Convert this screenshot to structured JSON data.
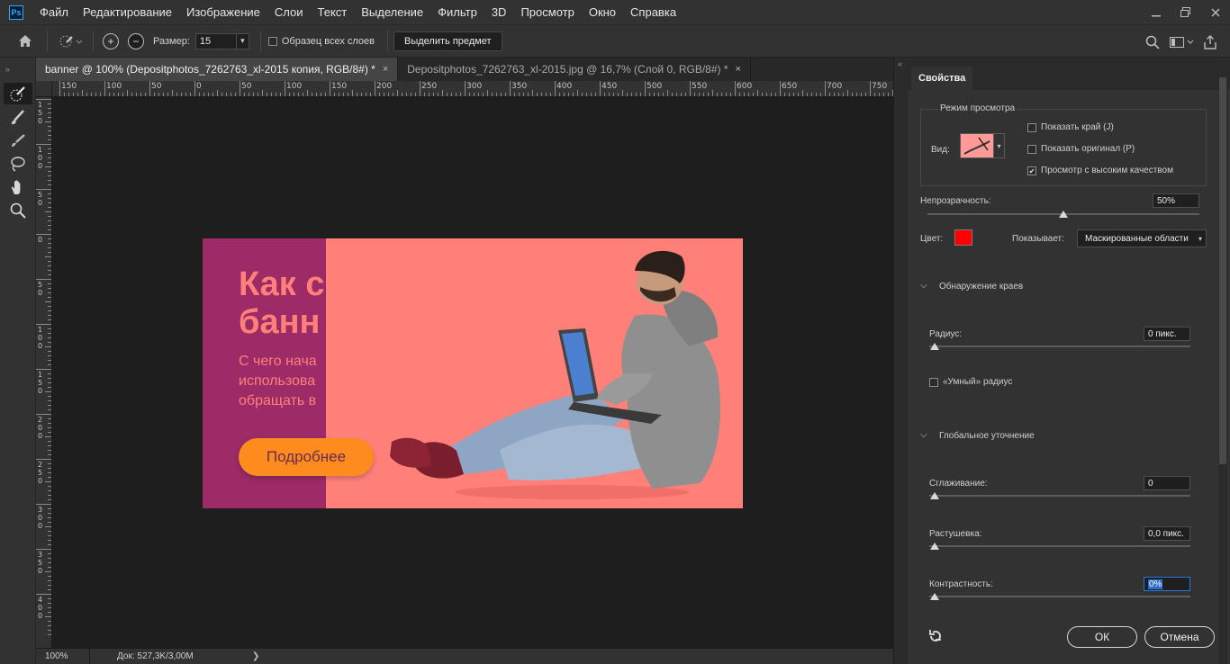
{
  "app": {
    "logo_text": "Ps"
  },
  "menu": [
    "Файл",
    "Редактирование",
    "Изображение",
    "Слои",
    "Текст",
    "Выделение",
    "Фильтр",
    "3D",
    "Просмотр",
    "Окно",
    "Справка"
  ],
  "options_bar": {
    "size_label": "Размер:",
    "size_value": "15",
    "sample_all_layers": "Образец всех слоев",
    "select_subject": "Выделить предмет"
  },
  "tabs": [
    {
      "label": "banner @ 100% (Depositphotos_7262763_xl-2015 копия, RGB/8#) *",
      "active": true
    },
    {
      "label": "Depositphotos_7262763_xl-2015.jpg @ 16,7% (Слой 0, RGB/8#) *",
      "active": false
    }
  ],
  "tab_close": "×",
  "ruler": {
    "top_labels": [
      "150",
      "100",
      "50",
      "0",
      "50",
      "100",
      "150",
      "200",
      "250",
      "300",
      "350",
      "400",
      "450",
      "500",
      "550",
      "600",
      "650",
      "700",
      "750"
    ],
    "left_labels": [
      "150",
      "100",
      "50",
      "0",
      "50",
      "100",
      "150",
      "200",
      "250",
      "300",
      "350",
      "400"
    ]
  },
  "banner": {
    "title_line1": "Как с",
    "title_line2": "банн",
    "sub_line1": "С чего нача",
    "sub_line2": "использова",
    "sub_line3": "обращать в",
    "button": "Подробнее",
    "colors": {
      "bg": "#fe8079",
      "left": "#9c2b67",
      "button": "#fe8b1e"
    }
  },
  "status": {
    "zoom": "100%",
    "doc": "Док: 527,3K/3,00M",
    "arrow": "❯"
  },
  "panel": {
    "tab": "Свойства",
    "view_mode_title": "Режим просмотра",
    "view_label": "Вид:",
    "show_edge": "Показать край (J)",
    "show_original": "Показать оригинал (P)",
    "high_quality": "Просмотр с высоким качеством",
    "high_quality_checked": true,
    "opacity_label": "Непрозрачность:",
    "opacity_value": "50%",
    "opacity_level": 0.5,
    "color_label": "Цвет:",
    "color_value": "#ff0000",
    "shows_label": "Показывает:",
    "shows_value": "Маскированные области",
    "edge_detection_title": "Обнаружение краев",
    "radius_label": "Радиус:",
    "radius_value": "0 пикс.",
    "smart_radius": "«Умный» радиус",
    "global_refine_title": "Глобальное уточнение",
    "smooth_label": "Сглаживание:",
    "smooth_value": "0",
    "feather_label": "Растушевка:",
    "feather_value": "0,0 пикс.",
    "contrast_label": "Контрастность:",
    "contrast_value": "0%",
    "ok": "ОК",
    "cancel": "Отмена"
  }
}
